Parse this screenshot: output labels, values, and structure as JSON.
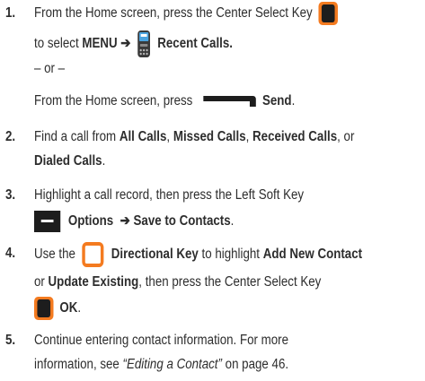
{
  "steps": [
    {
      "number": "1.",
      "line1_text": "From the Home screen, press the Center Select Key",
      "line2_pre": "to select ",
      "menu": "MENU",
      "arrow": "➔",
      "recent_calls": "Recent Calls.",
      "or": "– or –",
      "line4_text": "From the Home screen, press",
      "send": "Send",
      "period": "."
    },
    {
      "number": "2.",
      "pre": "Find a call from ",
      "all_calls": "All Calls",
      "comma1": ", ",
      "missed_calls": "Missed Calls",
      "comma2": ", ",
      "received_calls": "Received Calls",
      "comma3": ", or",
      "dialed_calls": "Dialed Calls",
      "period": "."
    },
    {
      "number": "3.",
      "line1": "Highlight a call record, then press the Left Soft Key",
      "options": "Options",
      "arrow": "➔",
      "save_to_contacts": "Save to Contacts",
      "period": "."
    },
    {
      "number": "4.",
      "pre": "Use the",
      "directional_key": "Directional Key",
      "mid": " to highlight ",
      "add_new_contact": "Add New Contact",
      "or": "or ",
      "update_existing": "Update Existing",
      "line2_rest": ", then press the Center Select Key",
      "ok": "OK",
      "period": "."
    },
    {
      "number": "5.",
      "line1": "Continue entering contact information. For more",
      "line2_pre": "information, see ",
      "link": "“Editing a Contact”",
      "line2_post": " on page 46."
    }
  ],
  "icons": {
    "center_key": "center-select-key-icon",
    "phone": "phone-menu-icon",
    "send": "send-key-icon",
    "soft_key": "left-soft-key-icon",
    "directional": "directional-key-icon"
  },
  "colors": {
    "accent": "#f47b20",
    "key": "#1d1d1d",
    "text": "#2d2d2d"
  }
}
